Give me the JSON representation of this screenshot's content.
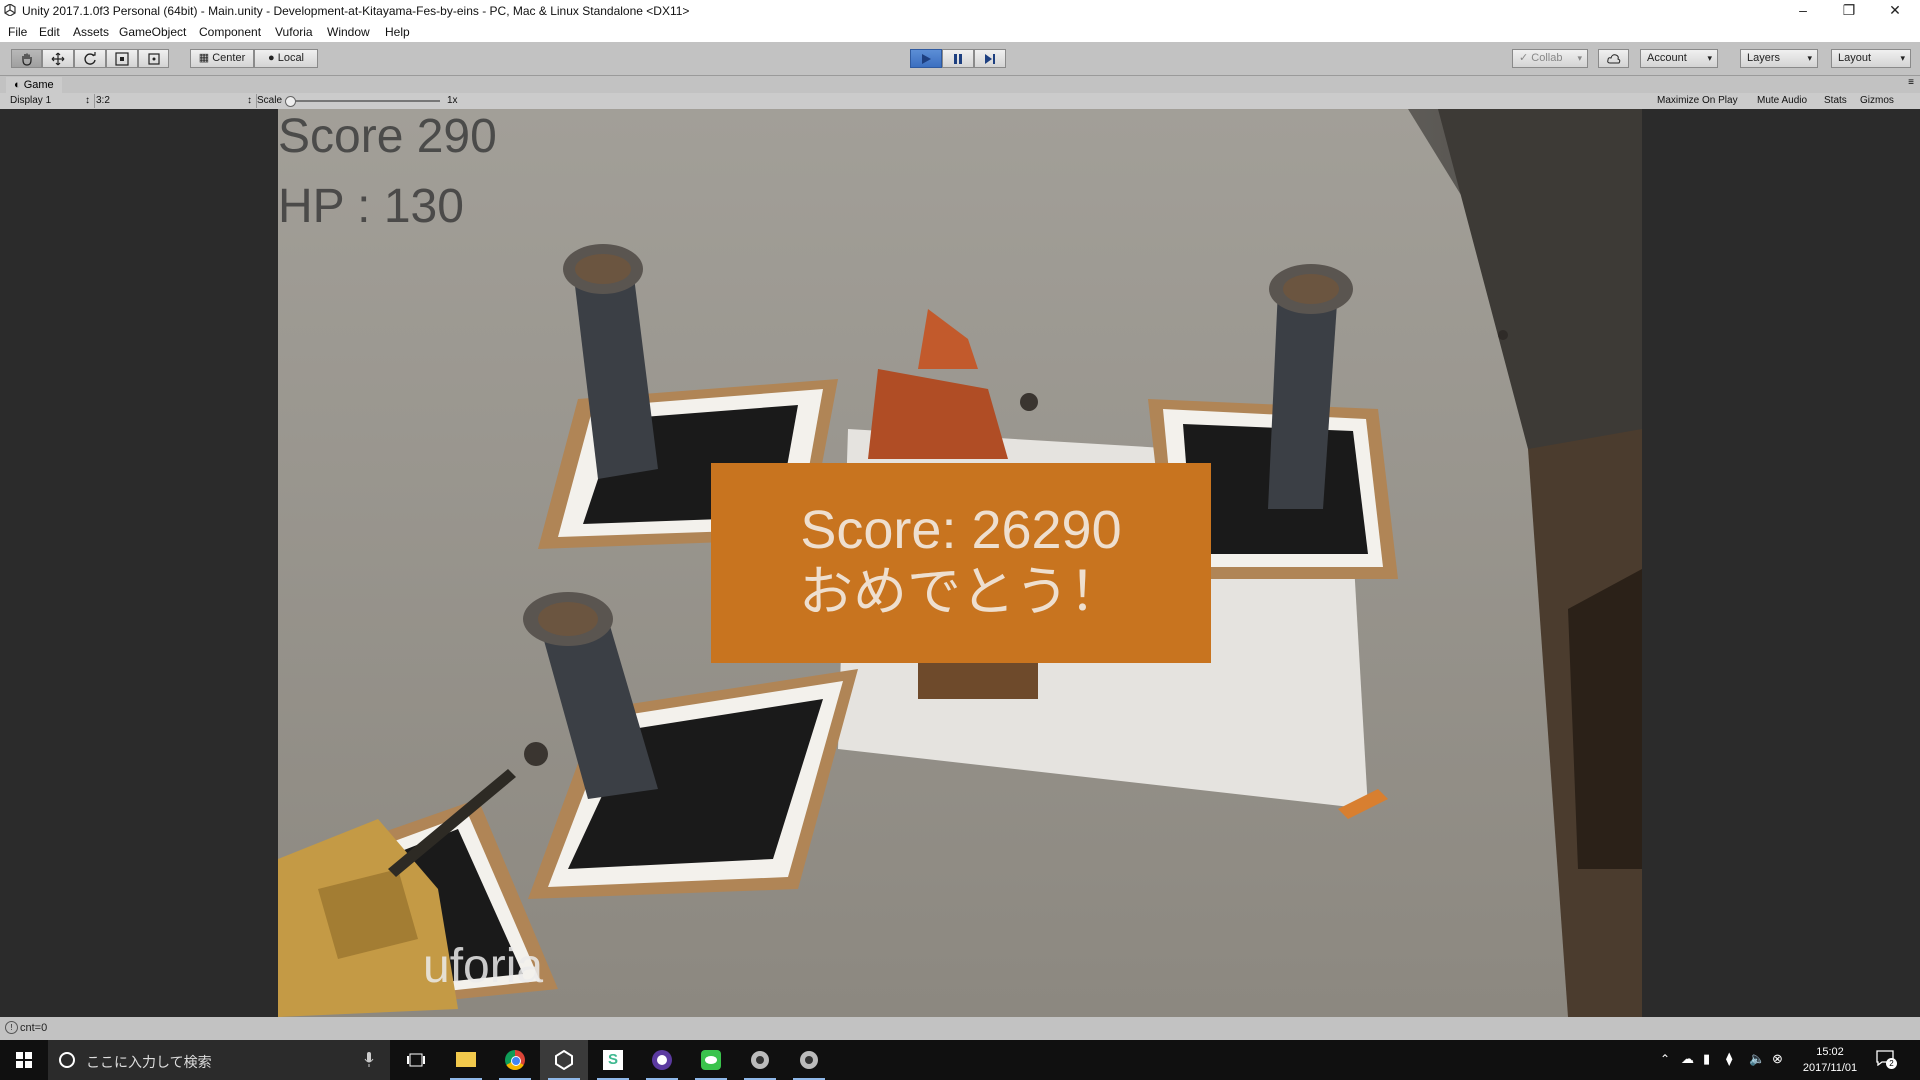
{
  "window": {
    "title": "Unity 2017.1.0f3 Personal (64bit) - Main.unity - Development-at-Kitayama-Fes-by-eins - PC, Mac & Linux Standalone <DX11>",
    "minimize_icon": "minimize-icon",
    "restore_icon": "restore-icon",
    "close_icon": "close-icon"
  },
  "menu": [
    "File",
    "Edit",
    "Assets",
    "GameObject",
    "Component",
    "Vuforia",
    "Window",
    "Help"
  ],
  "toolbar": {
    "pivot_label": "Center",
    "space_label": "Local",
    "collab_label": "Collab",
    "account_label": "Account",
    "layers_label": "Layers",
    "layout_label": "Layout"
  },
  "game_panel": {
    "tab_label": "Game",
    "display": "Display 1",
    "aspect": "3:2",
    "scale_label": "Scale",
    "scale_value": 0,
    "scale_display": "1x",
    "toggles": [
      "Maximize On Play",
      "Mute Audio",
      "Stats",
      "Gizmos"
    ]
  },
  "game": {
    "score_hud": "Score 290",
    "hp_hud": "HP : 130",
    "result_score": "Score: 26290",
    "result_message": "おめでとう！",
    "watermark": "uforia"
  },
  "statusbar": {
    "message": "cnt=0"
  },
  "taskbar": {
    "search_placeholder": "ここに入力して検索",
    "time": "15:02",
    "date": "2017/11/01",
    "notification_count": "2",
    "apps": [
      "task-view-icon",
      "file-explorer-icon",
      "chrome-icon",
      "unity-icon",
      "slack-icon",
      "purple-app-icon",
      "line-icon",
      "app-icon",
      "app-icon"
    ]
  },
  "colors": {
    "dialog_bg": "#c8741f",
    "dialog_text": "#eedfcf",
    "play_active": "#3b6fc0"
  }
}
